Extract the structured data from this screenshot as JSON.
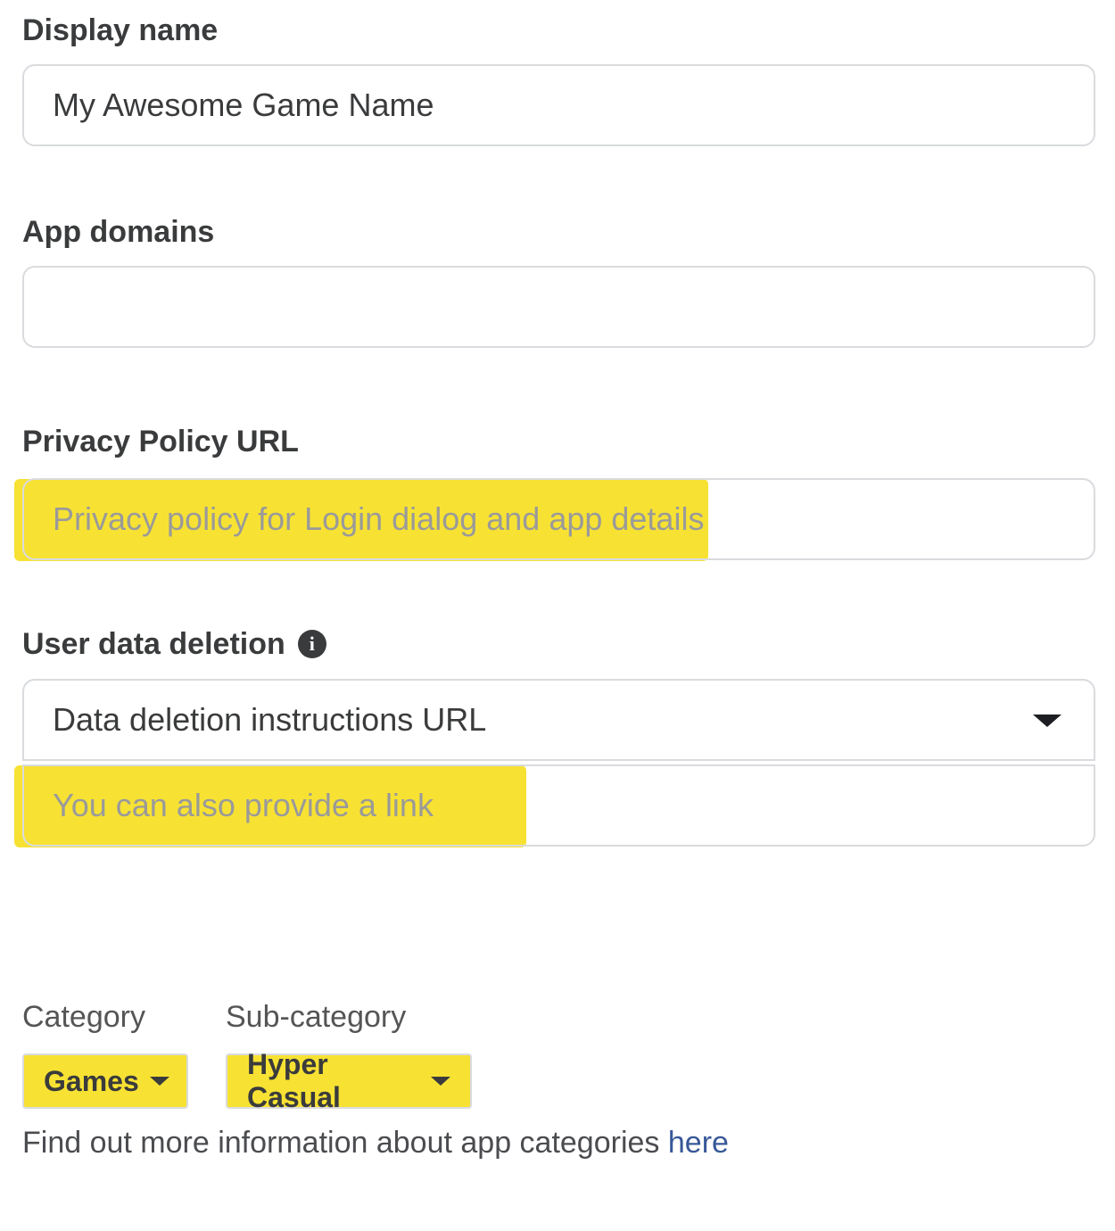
{
  "display_name": {
    "label": "Display name",
    "value": "My Awesome Game Name"
  },
  "app_domains": {
    "label": "App domains",
    "value": ""
  },
  "privacy_policy": {
    "label": "Privacy Policy URL",
    "placeholder": "Privacy policy for Login dialog and app details"
  },
  "user_data_deletion": {
    "label": "User data deletion",
    "info_icon": "info-icon",
    "select_value": "Data deletion instructions URL",
    "url_placeholder": "You can also provide a link"
  },
  "category": {
    "label": "Category",
    "value": "Games"
  },
  "subcategory": {
    "label": "Sub-category",
    "value": "Hyper Casual"
  },
  "footer": {
    "text": "Find out more information about app categories ",
    "link_text": "here"
  },
  "colors": {
    "highlight": "#f7e233",
    "link": "#385898",
    "border": "#d9dbde"
  }
}
